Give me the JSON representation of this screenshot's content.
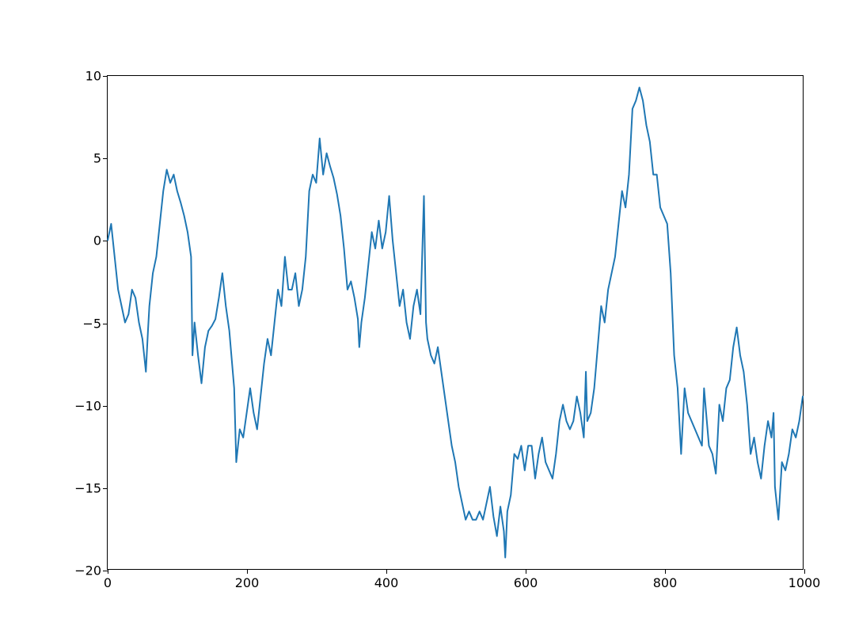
{
  "chart_data": {
    "type": "line",
    "title": "",
    "xlabel": "",
    "ylabel": "",
    "xlim": [
      0,
      1000
    ],
    "ylim": [
      -20,
      10
    ],
    "grid": false,
    "line_color": "#1f77b4",
    "x_ticks": [
      0,
      200,
      400,
      600,
      800,
      1000
    ],
    "y_ticks": [
      -20,
      -15,
      -10,
      -5,
      0,
      5,
      10
    ],
    "x_tick_labels": [
      "0",
      "200",
      "400",
      "600",
      "800",
      "1000"
    ],
    "y_tick_labels": [
      "−20",
      "−15",
      "−10",
      "−5",
      "0",
      "5",
      "10"
    ],
    "series": [
      {
        "name": "series1",
        "x": [
          0,
          5,
          10,
          15,
          20,
          25,
          30,
          35,
          40,
          45,
          50,
          55,
          58,
          60,
          65,
          70,
          75,
          80,
          85,
          90,
          95,
          100,
          105,
          110,
          115,
          120,
          122,
          125,
          130,
          135,
          140,
          145,
          150,
          155,
          160,
          165,
          170,
          175,
          178,
          182,
          185,
          190,
          195,
          200,
          205,
          210,
          215,
          220,
          225,
          230,
          235,
          240,
          245,
          250,
          255,
          260,
          265,
          270,
          275,
          280,
          285,
          290,
          295,
          300,
          305,
          310,
          315,
          320,
          325,
          330,
          335,
          340,
          345,
          350,
          355,
          360,
          362,
          365,
          370,
          375,
          380,
          385,
          390,
          395,
          400,
          405,
          410,
          415,
          420,
          425,
          430,
          435,
          440,
          445,
          450,
          455,
          458,
          460,
          465,
          470,
          475,
          480,
          485,
          490,
          495,
          500,
          505,
          510,
          515,
          520,
          525,
          530,
          535,
          540,
          545,
          550,
          555,
          560,
          565,
          570,
          572,
          575,
          580,
          585,
          590,
          595,
          600,
          605,
          610,
          615,
          620,
          625,
          630,
          635,
          640,
          645,
          650,
          655,
          660,
          665,
          670,
          675,
          680,
          685,
          688,
          690,
          695,
          700,
          705,
          710,
          715,
          720,
          725,
          730,
          735,
          740,
          745,
          750,
          755,
          760,
          765,
          770,
          775,
          780,
          785,
          790,
          795,
          800,
          805,
          810,
          815,
          820,
          825,
          830,
          835,
          840,
          845,
          850,
          855,
          858,
          860,
          865,
          870,
          875,
          880,
          885,
          890,
          895,
          900,
          905,
          910,
          915,
          920,
          925,
          930,
          935,
          940,
          945,
          950,
          955,
          958,
          960,
          965,
          970,
          975,
          980,
          985,
          990,
          995,
          1000
        ],
        "y": [
          0,
          1,
          -1,
          -3,
          -4,
          -5,
          -4.5,
          -3,
          -3.5,
          -5,
          -6,
          -8,
          -5.5,
          -4,
          -2,
          -1,
          1,
          3,
          4.3,
          3.5,
          4,
          3,
          2.3,
          1.5,
          0.5,
          -1,
          -7,
          -5,
          -7,
          -8.7,
          -6.5,
          -5.5,
          -5.2,
          -4.8,
          -3.5,
          -2,
          -4,
          -5.5,
          -7,
          -9,
          -13.5,
          -11.5,
          -12,
          -10.5,
          -9,
          -10.5,
          -11.5,
          -9.5,
          -7.5,
          -6,
          -7,
          -5,
          -3,
          -4,
          -1,
          -3,
          -3,
          -2,
          -4,
          -3,
          -1,
          3,
          4,
          3.5,
          6.2,
          4,
          5.3,
          4.5,
          3.8,
          2.8,
          1.5,
          -0.5,
          -3,
          -2.5,
          -3.5,
          -4.8,
          -6.5,
          -5,
          -3.5,
          -1.5,
          0.5,
          -0.5,
          1.2,
          -0.5,
          0.5,
          2.7,
          0,
          -2,
          -4,
          -3,
          -5,
          -6,
          -4,
          -3,
          -4.5,
          2.7,
          -5,
          -6,
          -7,
          -7.5,
          -6.5,
          -8,
          -9.5,
          -11,
          -12.5,
          -13.5,
          -15,
          -16,
          -17,
          -16.5,
          -17,
          -17,
          -16.5,
          -17,
          -16,
          -15,
          -16.8,
          -18,
          -16.2,
          -17.7,
          -19.3,
          -16.5,
          -15.5,
          -13,
          -13.3,
          -12.5,
          -14,
          -12.5,
          -12.5,
          -14.5,
          -13,
          -12,
          -13.5,
          -14,
          -14.5,
          -13,
          -11,
          -10,
          -11,
          -11.5,
          -11,
          -9.5,
          -10.5,
          -12,
          -8,
          -11,
          -10.5,
          -9,
          -6.5,
          -4,
          -5,
          -3,
          -2,
          -1,
          1,
          3,
          2,
          4,
          8,
          8.5,
          9.3,
          8.5,
          7,
          6,
          4,
          4,
          2,
          1.5,
          1,
          -2,
          -7,
          -9,
          -13,
          -9,
          -10.5,
          -11,
          -11.5,
          -12,
          -12.5,
          -9,
          -10,
          -12.5,
          -13,
          -14.2,
          -10,
          -11,
          -9,
          -8.5,
          -6.5,
          -5.3,
          -7,
          -8,
          -10,
          -13,
          -12,
          -13.5,
          -14.5,
          -12.5,
          -11,
          -12,
          -10.5,
          -15,
          -17,
          -13.5,
          -14,
          -13,
          -11.5,
          -12,
          -11,
          -9.5,
          -10.5
        ]
      }
    ]
  }
}
